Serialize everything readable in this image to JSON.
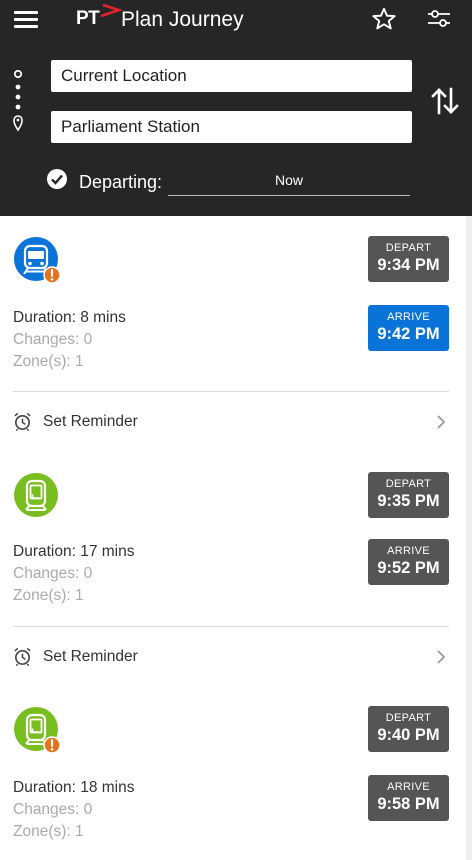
{
  "header": {
    "logo_text": "PT",
    "title": "Plan Journey",
    "from_value": "Current Location",
    "to_value": "Parliament Station",
    "departing_label": "Departing:",
    "departing_value": "Now",
    "icons": [
      "menu-icon",
      "star-icon",
      "filter-icon",
      "swap-icon",
      "clock-check-icon",
      "route-dots-icon"
    ]
  },
  "journeys": [
    {
      "mode": "train",
      "mode_color": "#0a73d8",
      "alert": true,
      "depart_label": "DEPART",
      "depart_time": "9:34 PM",
      "arrive_label": "ARRIVE",
      "arrive_time": "9:42 PM",
      "arrive_highlight": true,
      "duration": "Duration: 8 mins",
      "changes": "Changes: 0",
      "zones": "Zone(s): 1",
      "reminder_label": "Set Reminder"
    },
    {
      "mode": "tram",
      "mode_color": "#78be20",
      "alert": false,
      "depart_label": "DEPART",
      "depart_time": "9:35 PM",
      "arrive_label": "ARRIVE",
      "arrive_time": "9:52 PM",
      "arrive_highlight": false,
      "duration": "Duration: 17 mins",
      "changes": "Changes: 0",
      "zones": "Zone(s): 1",
      "reminder_label": "Set Reminder"
    },
    {
      "mode": "tram",
      "mode_color": "#78be20",
      "alert": true,
      "depart_label": "DEPART",
      "depart_time": "9:40 PM",
      "arrive_label": "ARRIVE",
      "arrive_time": "9:58 PM",
      "arrive_highlight": false,
      "duration": "Duration: 18 mins",
      "changes": "Changes: 0",
      "zones": "Zone(s): 1"
    }
  ],
  "colors": {
    "header_bg": "#262626",
    "train_blue": "#0a73d8",
    "tram_green": "#78be20",
    "alert_orange": "#e8711c",
    "badge_grey": "#555555",
    "logo_red": "#e4242c"
  }
}
